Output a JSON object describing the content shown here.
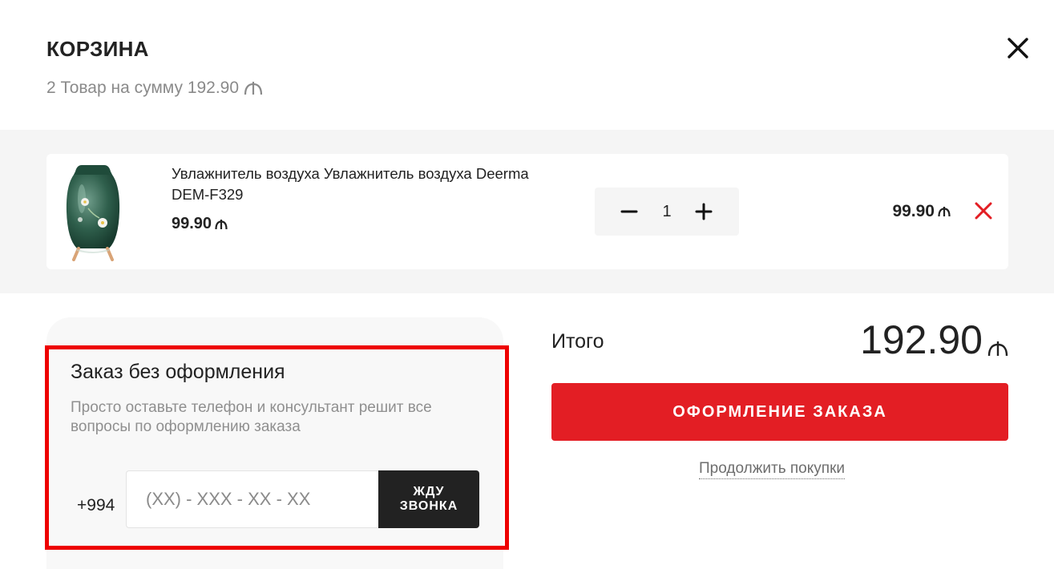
{
  "header": {
    "title": "КОРЗИНА",
    "subtitle": "2 Товар на сумму 192.90",
    "currency_icon": "manat-icon",
    "close_icon": "close-icon"
  },
  "cart": {
    "items": [
      {
        "name": "Увлажнитель воздуха Увлажнитель воздуха Deerma DEM-F329",
        "price": "99.90",
        "quantity": "1",
        "line_total": "99.90",
        "image": "green-humidifier-image"
      }
    ]
  },
  "quick_order": {
    "title": "Заказ без оформления",
    "description": "Просто оставьте телефон и консультант решит все вопросы по оформлению заказа",
    "phone_prefix": "+994",
    "phone_placeholder": "(XX) - XXX - XX - XX",
    "button_label": "ЖДУ ЗВОНКА"
  },
  "summary": {
    "total_label": "Итого",
    "total_value": "192.90",
    "checkout_label": "ОФОРМЛЕНИЕ ЗАКАЗА",
    "continue_label": "Продолжить покупки"
  },
  "colors": {
    "accent_red": "#e31e24",
    "highlight_red": "#ee0000",
    "dark_button": "#222222",
    "muted_text": "#8a8a8a"
  }
}
